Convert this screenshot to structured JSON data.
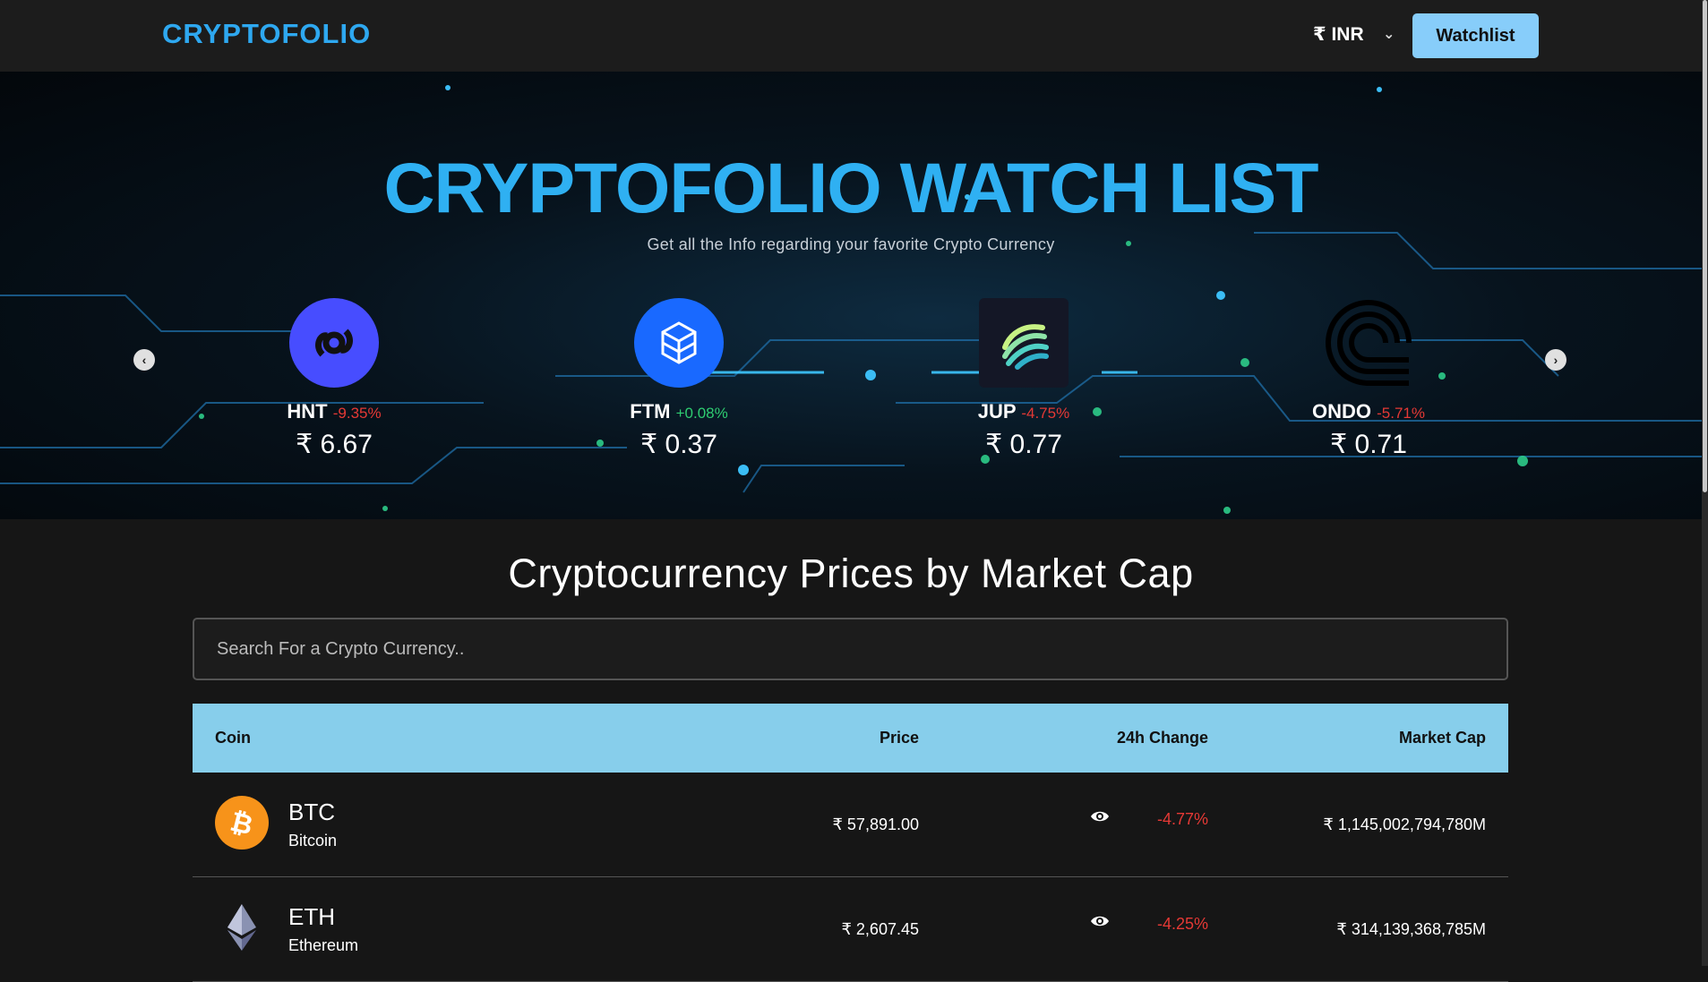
{
  "header": {
    "brand": "CRYPTOFOLIO",
    "currency": "₹ INR",
    "watchlist_label": "Watchlist"
  },
  "banner": {
    "title": "CRYPTOFOLIO WATCH LIST",
    "subtitle": "Get all the Info regarding your favorite Crypto Currency",
    "coins": [
      {
        "symbol": "HNT",
        "change": "-9.35%",
        "price": "₹ 6.67",
        "direction": "down",
        "icon": "helium-icon",
        "color": "#474dff"
      },
      {
        "symbol": "FTM",
        "change": "+0.08%",
        "price": "₹ 0.37",
        "direction": "up",
        "icon": "fantom-icon",
        "color": "#1969ff"
      },
      {
        "symbol": "JUP",
        "change": "-4.75%",
        "price": "₹ 0.77",
        "direction": "down",
        "icon": "jupiter-icon",
        "color": "#141726"
      },
      {
        "symbol": "ONDO",
        "change": "-5.71%",
        "price": "₹ 0.71",
        "direction": "down",
        "icon": "ondo-icon",
        "color": "#000000"
      }
    ]
  },
  "section": {
    "title": "Cryptocurrency Prices by Market Cap",
    "search_placeholder": "Search For a Crypto Currency.."
  },
  "table": {
    "headers": {
      "coin": "Coin",
      "price": "Price",
      "change": "24h Change",
      "market_cap": "Market Cap"
    },
    "rows": [
      {
        "symbol": "BTC",
        "name": "Bitcoin",
        "price": "₹ 57,891.00",
        "change": "-4.77%",
        "market_cap": "₹ 1,145,002,794,780M",
        "icon": "bitcoin-icon",
        "color": "#f7931a"
      },
      {
        "symbol": "ETH",
        "name": "Ethereum",
        "price": "₹ 2,607.45",
        "change": "-4.25%",
        "market_cap": "₹ 314,139,368,785M",
        "icon": "ethereum-icon",
        "color": "#627eea"
      }
    ]
  }
}
